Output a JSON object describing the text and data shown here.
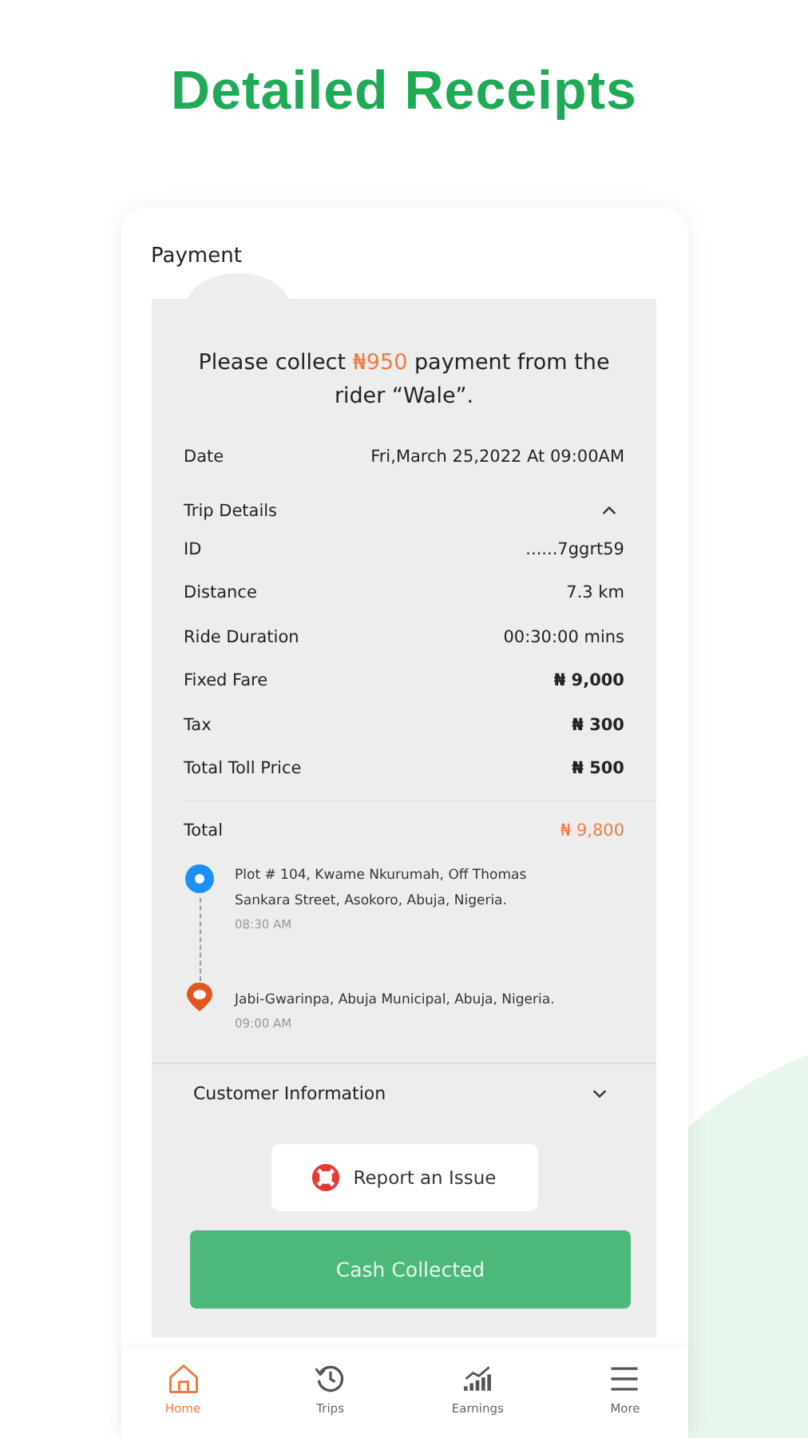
{
  "headline": "Detailed Receipts",
  "screen_title": "Payment",
  "prompt": "Please collect **₦950** payment from the rider “Wale”.",
  "date": {
    "label": "Date",
    "value": "Fri,March 25,2022 At 09:00AM"
  },
  "trip_details": {
    "label": "Trip Details",
    "expanded": true,
    "rows": [
      {
        "label": "ID",
        "value": "......7ggrt59",
        "bold": false
      },
      {
        "label": "Distance",
        "value": "7.3 km",
        "bold": false
      },
      {
        "label": "Ride Duration",
        "value": "00:30:00 mins",
        "bold": false
      },
      {
        "label": "Fixed Fare",
        "value": "₦ 9,000",
        "bold": true
      },
      {
        "label": "Tax",
        "value": "₦ 300",
        "bold": true
      },
      {
        "label": "Total Toll Price",
        "value": "₦ 500",
        "bold": true
      }
    ]
  },
  "total": {
    "label": "Total",
    "value": "₦ 9,800"
  },
  "stops": [
    {
      "kind": "pickup",
      "address": "Plot # 104, Kwame Nkurumah, Off Thomas Sankara Street, Asokoro, Abuja, Nigeria.",
      "time": "08:30 AM"
    },
    {
      "kind": "dropoff",
      "address": "Jabi-Gwarinpa, Abuja Municipal, Abuja, Nigeria.",
      "time": "09:00 AM"
    }
  ],
  "customer_info": {
    "label": "Customer Information",
    "expanded": false
  },
  "report_button": "Report an Issue",
  "primary_button": "Cash Collected",
  "nav": [
    {
      "kind": "home",
      "label": "Home",
      "selected": true
    },
    {
      "kind": "trips",
      "label": "Trips",
      "selected": false
    },
    {
      "kind": "earnings",
      "label": "Earnings",
      "selected": false
    },
    {
      "kind": "more",
      "label": "More",
      "selected": false
    }
  ]
}
